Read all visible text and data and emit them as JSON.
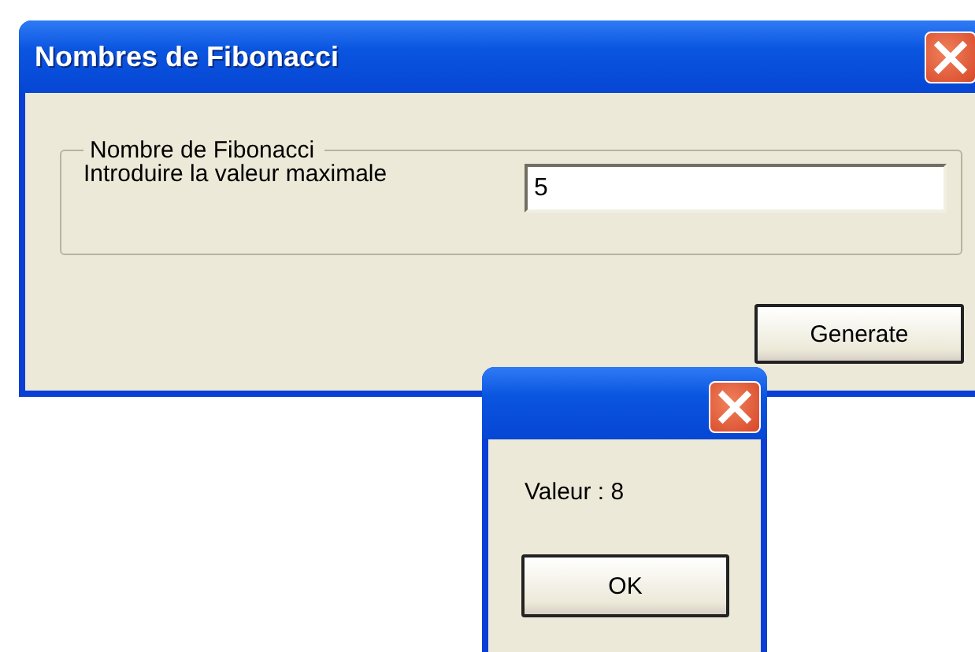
{
  "main_window": {
    "title": "Nombres de Fibonacci",
    "group": {
      "legend": "Nombre de Fibonacci",
      "label": "Introduire la valeur maximale",
      "input": {
        "value": "5"
      }
    },
    "button": "Generate"
  },
  "message_box": {
    "message": "Valeur : 8",
    "button": "OK"
  }
}
